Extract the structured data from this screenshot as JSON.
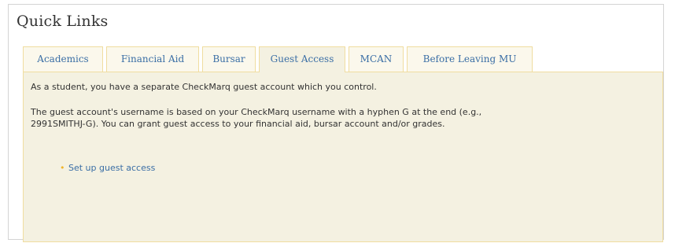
{
  "title": "Quick Links",
  "tabs": [
    {
      "label": "Academics",
      "active": false
    },
    {
      "label": "Financial Aid",
      "active": false
    },
    {
      "label": "Bursar",
      "active": false
    },
    {
      "label": "Guest Access",
      "active": true
    },
    {
      "label": "MCAN",
      "active": false
    },
    {
      "label": "Before Leaving MU",
      "active": false
    }
  ],
  "panel": {
    "intro": "As a student, you have a separate CheckMarq guest account which you control.",
    "details_line1": "The guest account's username is based on your CheckMarq username with a hyphen G at the end (e.g.,",
    "details_line2": "2991SMITHJ-G). You can grant guest access to your financial aid, bursar account and/or grades.",
    "bullet": "•",
    "link_label": "Set up guest access"
  },
  "colors": {
    "tab_text": "#3a6ea5",
    "tab_border": "#f0dda0",
    "panel_bg": "#f4f1e1",
    "bullet": "#f0b429"
  }
}
